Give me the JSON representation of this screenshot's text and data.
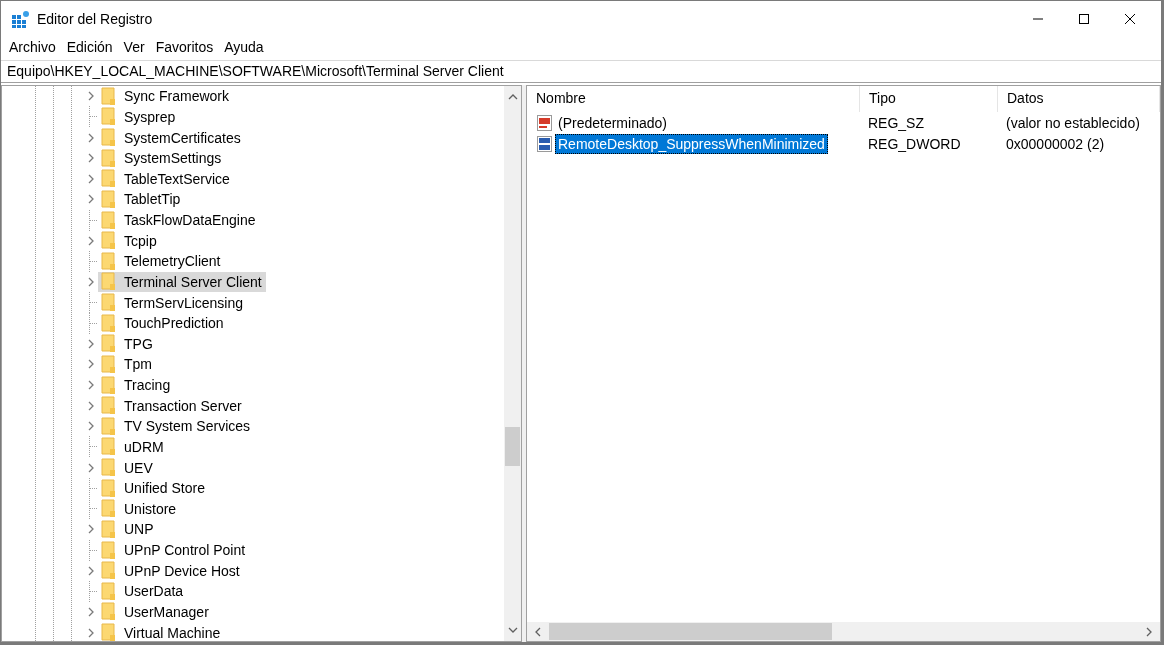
{
  "window": {
    "title": "Editor del Registro"
  },
  "menu": [
    "Archivo",
    "Edición",
    "Ver",
    "Favoritos",
    "Ayuda"
  ],
  "address": "Equipo\\HKEY_LOCAL_MACHINE\\SOFTWARE\\Microsoft\\Terminal Server Client",
  "tree": {
    "items": [
      {
        "name": "Sync Framework",
        "expandable": true,
        "selected": false
      },
      {
        "name": "Sysprep",
        "expandable": false,
        "selected": false
      },
      {
        "name": "SystemCertificates",
        "expandable": true,
        "selected": false
      },
      {
        "name": "SystemSettings",
        "expandable": true,
        "selected": false
      },
      {
        "name": "TableTextService",
        "expandable": true,
        "selected": false
      },
      {
        "name": "TabletTip",
        "expandable": true,
        "selected": false
      },
      {
        "name": "TaskFlowDataEngine",
        "expandable": false,
        "selected": false
      },
      {
        "name": "Tcpip",
        "expandable": true,
        "selected": false
      },
      {
        "name": "TelemetryClient",
        "expandable": false,
        "selected": false
      },
      {
        "name": "Terminal Server Client",
        "expandable": true,
        "selected": true
      },
      {
        "name": "TermServLicensing",
        "expandable": false,
        "selected": false
      },
      {
        "name": "TouchPrediction",
        "expandable": false,
        "selected": false
      },
      {
        "name": "TPG",
        "expandable": true,
        "selected": false
      },
      {
        "name": "Tpm",
        "expandable": true,
        "selected": false
      },
      {
        "name": "Tracing",
        "expandable": true,
        "selected": false
      },
      {
        "name": "Transaction Server",
        "expandable": true,
        "selected": false
      },
      {
        "name": "TV System Services",
        "expandable": true,
        "selected": false
      },
      {
        "name": "uDRM",
        "expandable": false,
        "selected": false
      },
      {
        "name": "UEV",
        "expandable": true,
        "selected": false
      },
      {
        "name": "Unified Store",
        "expandable": false,
        "selected": false
      },
      {
        "name": "Unistore",
        "expandable": false,
        "selected": false
      },
      {
        "name": "UNP",
        "expandable": true,
        "selected": false
      },
      {
        "name": "UPnP Control Point",
        "expandable": false,
        "selected": false
      },
      {
        "name": "UPnP Device Host",
        "expandable": true,
        "selected": false
      },
      {
        "name": "UserData",
        "expandable": false,
        "selected": false
      },
      {
        "name": "UserManager",
        "expandable": true,
        "selected": false
      },
      {
        "name": "Virtual Machine",
        "expandable": true,
        "selected": false
      }
    ]
  },
  "values": {
    "columns": [
      "Nombre",
      "Tipo",
      "Datos"
    ],
    "rows": [
      {
        "kind": "string",
        "name": "(Predeterminado)",
        "type": "REG_SZ",
        "data": "(valor no establecido)",
        "selected": false
      },
      {
        "kind": "binary",
        "name": "RemoteDesktop_SuppressWhenMinimized",
        "type": "REG_DWORD",
        "data": "0x00000002 (2)",
        "selected": true
      }
    ]
  }
}
